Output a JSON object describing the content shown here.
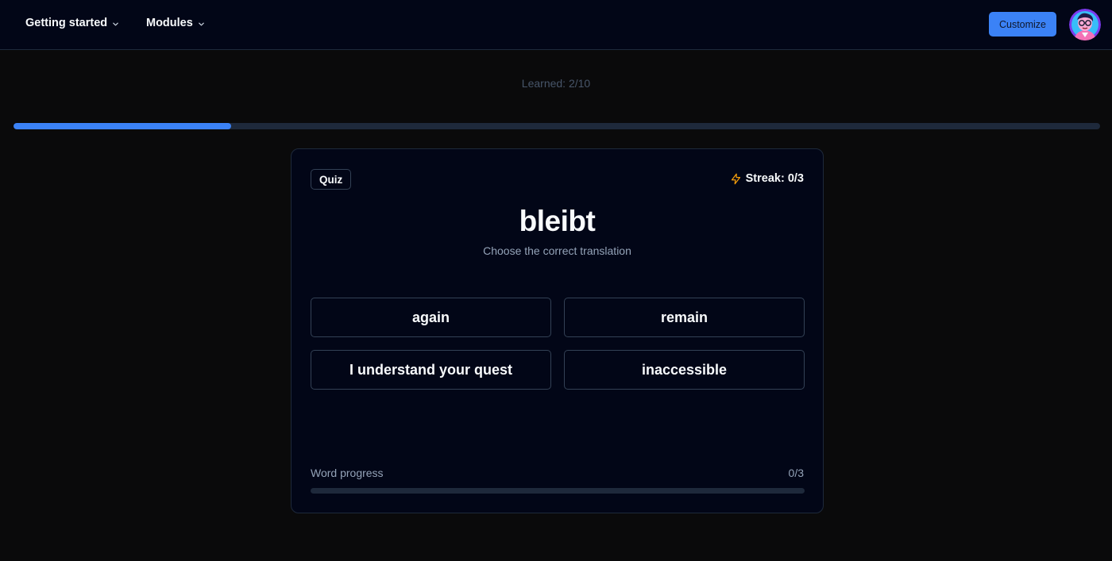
{
  "nav": {
    "items": [
      {
        "label": "Getting started",
        "icon": "chevron-down-icon"
      },
      {
        "label": "Modules",
        "icon": "chevron-down-icon"
      }
    ],
    "customize_label": "Customize",
    "avatar_icon": "user-avatar"
  },
  "learned": {
    "text": "Learned: 2/10",
    "fraction": 0.2
  },
  "card": {
    "badge": "Quiz",
    "streak_icon": "lightning-icon",
    "streak_text": "Streak: 0/3",
    "word": "bleibt",
    "instruction": "Choose the correct translation",
    "options": [
      "again",
      "remain",
      "I understand your quest",
      "inaccessible"
    ],
    "word_progress_label": "Word progress",
    "word_progress_value": "0/3",
    "word_progress_fraction": 0
  },
  "colors": {
    "accent": "#3b82f6",
    "streak": "#f59e0b",
    "background": "#0a0a0b",
    "card": "#020617"
  }
}
